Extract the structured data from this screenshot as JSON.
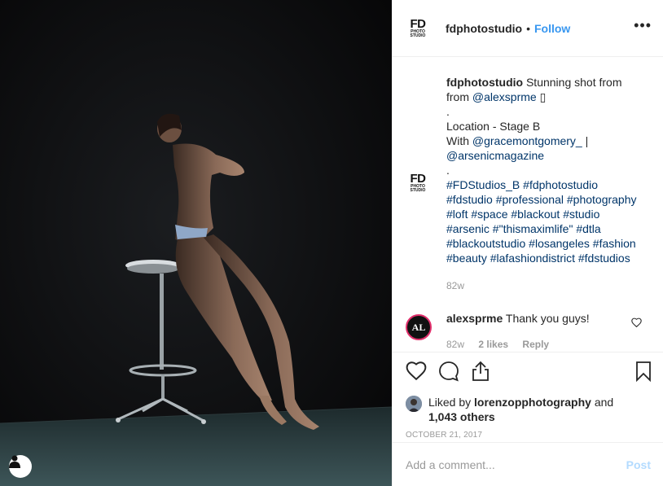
{
  "post": {
    "user_tag_icon": "person-icon"
  },
  "header": {
    "logo_text": "FD",
    "logo_subtext": "PHOTO STUDIO",
    "username": "fdphotostudio",
    "separator": "•",
    "follow_label": "Follow",
    "more_icon": "more-dots-icon"
  },
  "caption": {
    "username": "fdphotostudio",
    "line1": "Stunning shot from",
    "line2_prefix": "from ",
    "mention1": "@alexsprme",
    "emoji_box": "▯",
    "dot1": ".",
    "location": "Location - Stage B",
    "with_prefix": "With ",
    "mention2": "@gracemontgomery_",
    "pipe": " |",
    "mention3": "@arsenicmagazine",
    "dot2": ".",
    "hashtags_1": "#FDStudios_B #fdphotostudio",
    "hashtags_2": "#fdstudio #professional #photography",
    "hashtags_3": "#loft #space #blackout #studio",
    "hashtags_4": "#arsenic #\"thismaximlife\" #dtla",
    "hashtags_5": "#blackoutstudio #losangeles #fashion",
    "hashtags_6": "#beauty #lafashiondistrict #fdstudios",
    "timestamp": "82w"
  },
  "comment": {
    "avatar_text": "AL",
    "username": "alexsprme",
    "text": "Thank you guys!",
    "time": "82w",
    "likes": "2 likes",
    "reply": "Reply"
  },
  "actions": {
    "likes_prefix": "Liked by ",
    "liker": "lorenzopphotography",
    "likes_suffix": " and",
    "others": "1,043 others",
    "date": "OCTOBER 21, 2017"
  },
  "add_comment": {
    "placeholder": "Add a comment...",
    "post_label": "Post"
  }
}
